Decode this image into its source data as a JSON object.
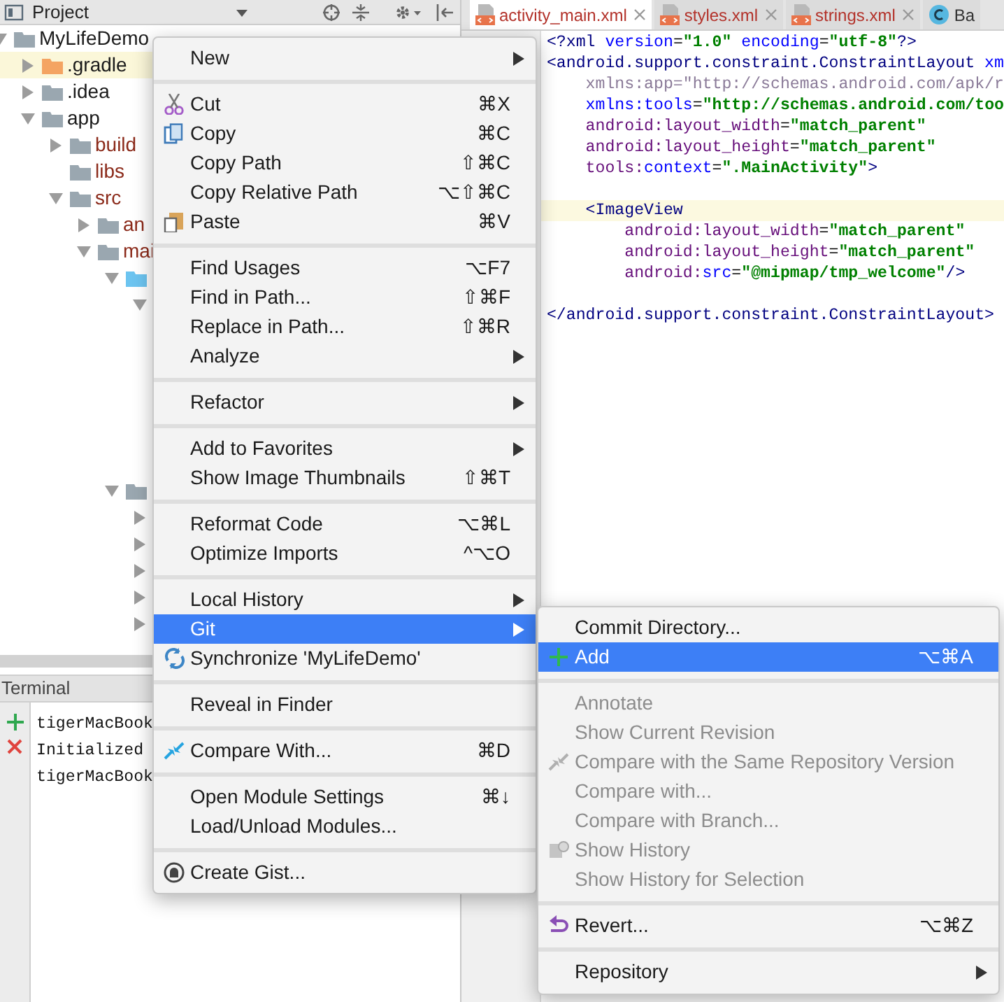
{
  "project_panel": {
    "title": "Project",
    "tree": [
      {
        "label": "MyLifeDemo",
        "expanded": true,
        "highlighted": false,
        "unversioned": false,
        "color": "#9aa7b0",
        "children": [
          {
            "label": ".gradle",
            "expanded": false,
            "highlighted": true,
            "unversioned": false,
            "color": "#f4a462"
          },
          {
            "label": ".idea",
            "expanded": false,
            "highlighted": false,
            "unversioned": false,
            "color": "#9aa7b0"
          },
          {
            "label": "app",
            "expanded": true,
            "highlighted": false,
            "unversioned": false,
            "color": "#9aa7b0",
            "children": [
              {
                "label": "build",
                "expanded": false,
                "highlighted": false,
                "unversioned": true,
                "color": "#9aa7b0"
              },
              {
                "label": "libs",
                "highlighted": false,
                "unversioned": true,
                "color": "#9aa7b0"
              },
              {
                "label": "src",
                "expanded": true,
                "highlighted": false,
                "unversioned": true,
                "color": "#9aa7b0",
                "children": [
                  {
                    "label": "an",
                    "expanded": false,
                    "highlighted": false,
                    "unversioned": true,
                    "color": "#9aa7b0"
                  },
                  {
                    "label": "mai",
                    "expanded": true,
                    "highlighted": false,
                    "unversioned": true,
                    "color": "#9aa7b0",
                    "children": [
                      {
                        "expanded": true,
                        "highlighted": false,
                        "color": "#6cc4f0",
                        "children": [
                          {
                            "expanded": true,
                            "highlighted": false
                          }
                        ]
                      },
                      {
                        "expanded": true,
                        "highlighted": false,
                        "color": "#9aa7b0",
                        "children": [
                          {
                            "expanded": false,
                            "highlighted": false
                          },
                          {
                            "expanded": false,
                            "highlighted": false
                          },
                          {
                            "expanded": false,
                            "highlighted": false
                          },
                          {
                            "expanded": false,
                            "highlighted": false
                          },
                          {
                            "expanded": false,
                            "highlighted": false
                          }
                        ]
                      }
                    ]
                  }
                ]
              }
            ]
          }
        ]
      }
    ]
  },
  "terminal": {
    "title": "Terminal",
    "lines": [
      "tigerMacBook",
      "Initialized",
      "tigerMacBook"
    ]
  },
  "editor": {
    "tabs": [
      {
        "label": "activity_main.xml",
        "selected": true,
        "unversioned": true,
        "closable": true
      },
      {
        "label": "styles.xml",
        "selected": false,
        "unversioned": true,
        "closable": true
      },
      {
        "label": "strings.xml",
        "selected": false,
        "unversioned": true,
        "closable": true
      },
      {
        "label": "Ba",
        "selected": false,
        "unversioned": false,
        "closable": false
      }
    ],
    "lines": [
      {
        "current": false,
        "segments": [
          {
            "kind": "tag",
            "text": "<?xml"
          },
          {
            "kind": "attr",
            "text": " version"
          },
          {
            "kind": "plain",
            "text": "="
          },
          {
            "kind": "str",
            "text": "\"1.0\""
          },
          {
            "kind": "attr",
            "text": " encoding"
          },
          {
            "kind": "plain",
            "text": "="
          },
          {
            "kind": "str",
            "text": "\"utf-8\""
          },
          {
            "kind": "tag",
            "text": "?>"
          }
        ]
      },
      {
        "current": false,
        "segments": [
          {
            "kind": "tag",
            "text": "<android.support.constraint.ConstraintLayout"
          },
          {
            "kind": "attr",
            "text": " xm"
          }
        ]
      },
      {
        "current": false,
        "segments": [
          {
            "kind": "unused",
            "text": "    xmlns:app=\"http://schemas.android.com/apk/r"
          }
        ]
      },
      {
        "current": false,
        "segments": [
          {
            "kind": "attr",
            "text": "    xmlns:tools"
          },
          {
            "kind": "plain",
            "text": "="
          },
          {
            "kind": "str",
            "text": "\"http://schemas.android.com/too"
          }
        ]
      },
      {
        "current": false,
        "segments": [
          {
            "kind": "ns",
            "text": "    android:layout_width"
          },
          {
            "kind": "plain",
            "text": "="
          },
          {
            "kind": "str",
            "text": "\"match_parent\""
          }
        ]
      },
      {
        "current": false,
        "segments": [
          {
            "kind": "ns",
            "text": "    android:layout_height"
          },
          {
            "kind": "plain",
            "text": "="
          },
          {
            "kind": "str",
            "text": "\"match_parent\""
          }
        ]
      },
      {
        "current": false,
        "segments": [
          {
            "kind": "ns",
            "text": "    tools:"
          },
          {
            "kind": "attr",
            "text": "context"
          },
          {
            "kind": "plain",
            "text": "="
          },
          {
            "kind": "str",
            "text": "\".MainActivity\""
          },
          {
            "kind": "tag",
            "text": ">"
          }
        ]
      },
      {
        "current": false
      },
      {
        "current": true,
        "segments": [
          {
            "kind": "tag",
            "text": "    <ImageView"
          }
        ]
      },
      {
        "current": false,
        "segments": [
          {
            "kind": "ns",
            "text": "        android:layout_width"
          },
          {
            "kind": "plain",
            "text": "="
          },
          {
            "kind": "str",
            "text": "\"match_parent\""
          }
        ]
      },
      {
        "current": false,
        "segments": [
          {
            "kind": "ns",
            "text": "        android:layout_height"
          },
          {
            "kind": "plain",
            "text": "="
          },
          {
            "kind": "str",
            "text": "\"match_parent\""
          }
        ]
      },
      {
        "current": false,
        "segments": [
          {
            "kind": "ns",
            "text": "        android:"
          },
          {
            "kind": "attr",
            "text": "src"
          },
          {
            "kind": "plain",
            "text": "="
          },
          {
            "kind": "str",
            "text": "\"@mipmap/tmp_welcome\""
          },
          {
            "kind": "tag",
            "text": "/>"
          }
        ]
      },
      {
        "current": false
      },
      {
        "current": false,
        "segments": [
          {
            "kind": "tag",
            "text": "</android.support.constraint.ConstraintLayout>"
          }
        ]
      }
    ]
  },
  "context_menu": {
    "groups": [
      [
        {
          "label": "New",
          "submenu": true,
          "selected": false
        }
      ],
      [
        {
          "label": "Cut",
          "shortcut": "⌘X",
          "submenu": false,
          "selected": false
        },
        {
          "label": "Copy",
          "shortcut": "⌘C",
          "submenu": false,
          "selected": false
        },
        {
          "label": "Copy Path",
          "shortcut": "⇧⌘C",
          "submenu": false,
          "selected": false
        },
        {
          "label": "Copy Relative Path",
          "shortcut": "⌥⇧⌘C",
          "submenu": false,
          "selected": false
        },
        {
          "label": "Paste",
          "shortcut": "⌘V",
          "submenu": false,
          "selected": false
        }
      ],
      [
        {
          "label": "Find Usages",
          "shortcut": "⌥F7",
          "submenu": false,
          "selected": false
        },
        {
          "label": "Find in Path...",
          "shortcut": "⇧⌘F",
          "submenu": false,
          "selected": false
        },
        {
          "label": "Replace in Path...",
          "shortcut": "⇧⌘R",
          "submenu": false,
          "selected": false
        },
        {
          "label": "Analyze",
          "submenu": true,
          "selected": false
        }
      ],
      [
        {
          "label": "Refactor",
          "submenu": true,
          "selected": false
        }
      ],
      [
        {
          "label": "Add to Favorites",
          "submenu": true,
          "selected": false
        },
        {
          "label": "Show Image Thumbnails",
          "shortcut": "⇧⌘T",
          "submenu": false,
          "selected": false
        }
      ],
      [
        {
          "label": "Reformat Code",
          "shortcut": "⌥⌘L",
          "submenu": false,
          "selected": false
        },
        {
          "label": "Optimize Imports",
          "shortcut": "^⌥O",
          "submenu": false,
          "selected": false
        }
      ],
      [
        {
          "label": "Local History",
          "submenu": true,
          "selected": false
        },
        {
          "label": "Git",
          "submenu": true,
          "selected": true
        },
        {
          "label": "Synchronize 'MyLifeDemo'",
          "submenu": false,
          "selected": false
        }
      ],
      [
        {
          "label": "Reveal in Finder",
          "submenu": false,
          "selected": false
        }
      ],
      [
        {
          "label": "Compare With...",
          "shortcut": "⌘D",
          "submenu": false,
          "selected": false
        }
      ],
      [
        {
          "label": "Open Module Settings",
          "shortcut": "⌘↓",
          "submenu": false,
          "selected": false
        },
        {
          "label": "Load/Unload Modules...",
          "submenu": false,
          "selected": false
        }
      ],
      [
        {
          "label": "Create Gist...",
          "submenu": false,
          "selected": false
        }
      ]
    ]
  },
  "git_submenu": {
    "groups": [
      [
        {
          "label": "Commit Directory...",
          "submenu": false,
          "selected": false,
          "disabled": false
        },
        {
          "label": "Add",
          "shortcut": "⌥⌘A",
          "submenu": false,
          "selected": true,
          "disabled": false
        }
      ],
      [
        {
          "label": "Annotate",
          "submenu": false,
          "selected": false,
          "disabled": true
        },
        {
          "label": "Show Current Revision",
          "submenu": false,
          "selected": false,
          "disabled": true
        },
        {
          "label": "Compare with the Same Repository Version",
          "submenu": false,
          "selected": false,
          "disabled": true
        },
        {
          "label": "Compare with...",
          "submenu": false,
          "selected": false,
          "disabled": true
        },
        {
          "label": "Compare with Branch...",
          "submenu": false,
          "selected": false,
          "disabled": true
        },
        {
          "label": "Show History",
          "submenu": false,
          "selected": false,
          "disabled": true
        },
        {
          "label": "Show History for Selection",
          "submenu": false,
          "selected": false,
          "disabled": true
        }
      ],
      [
        {
          "label": "Revert...",
          "shortcut": "⌥⌘Z",
          "submenu": false,
          "selected": false,
          "disabled": false
        }
      ],
      [
        {
          "label": "Repository",
          "submenu": true,
          "selected": false,
          "disabled": false
        }
      ]
    ]
  }
}
